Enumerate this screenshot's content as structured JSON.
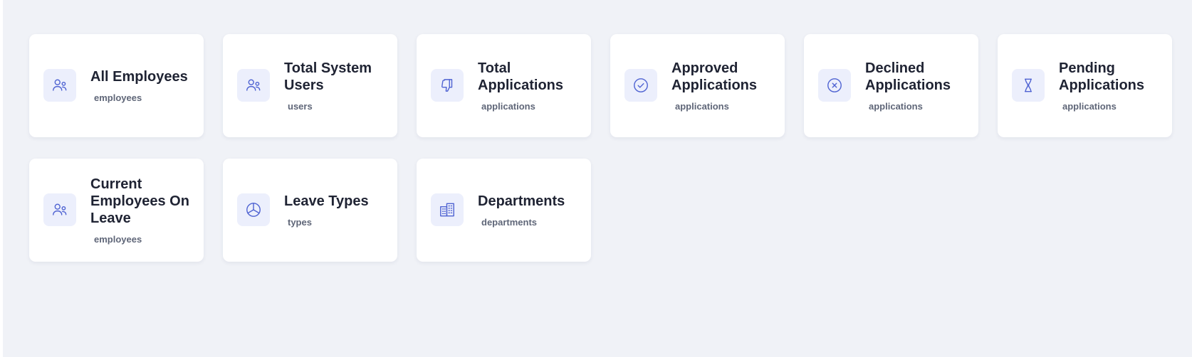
{
  "cards": [
    {
      "title": "All Employees",
      "unit": "employees",
      "icon": "users-icon"
    },
    {
      "title": "Total System Users",
      "unit": "users",
      "icon": "users-icon"
    },
    {
      "title": "Total Applications",
      "unit": "applications",
      "icon": "dislike-thumb-icon"
    },
    {
      "title": "Approved Applications",
      "unit": "applications",
      "icon": "check-circle-icon"
    },
    {
      "title": "Declined Applications",
      "unit": "applications",
      "icon": "x-circle-icon"
    },
    {
      "title": "Pending Applications",
      "unit": "applications",
      "icon": "hourglass-icon"
    },
    {
      "title": "Current Employees On Leave",
      "unit": "employees",
      "icon": "users-icon"
    },
    {
      "title": "Leave Types",
      "unit": "types",
      "icon": "pie-chart-icon"
    },
    {
      "title": "Departments",
      "unit": "departments",
      "icon": "buildings-icon"
    }
  ],
  "colors": {
    "background": "#f0f2f7",
    "card": "#ffffff",
    "icon_bg": "#eceffc",
    "accent": "#4f63d2",
    "title": "#1f2333",
    "subtitle": "#5f6678"
  }
}
